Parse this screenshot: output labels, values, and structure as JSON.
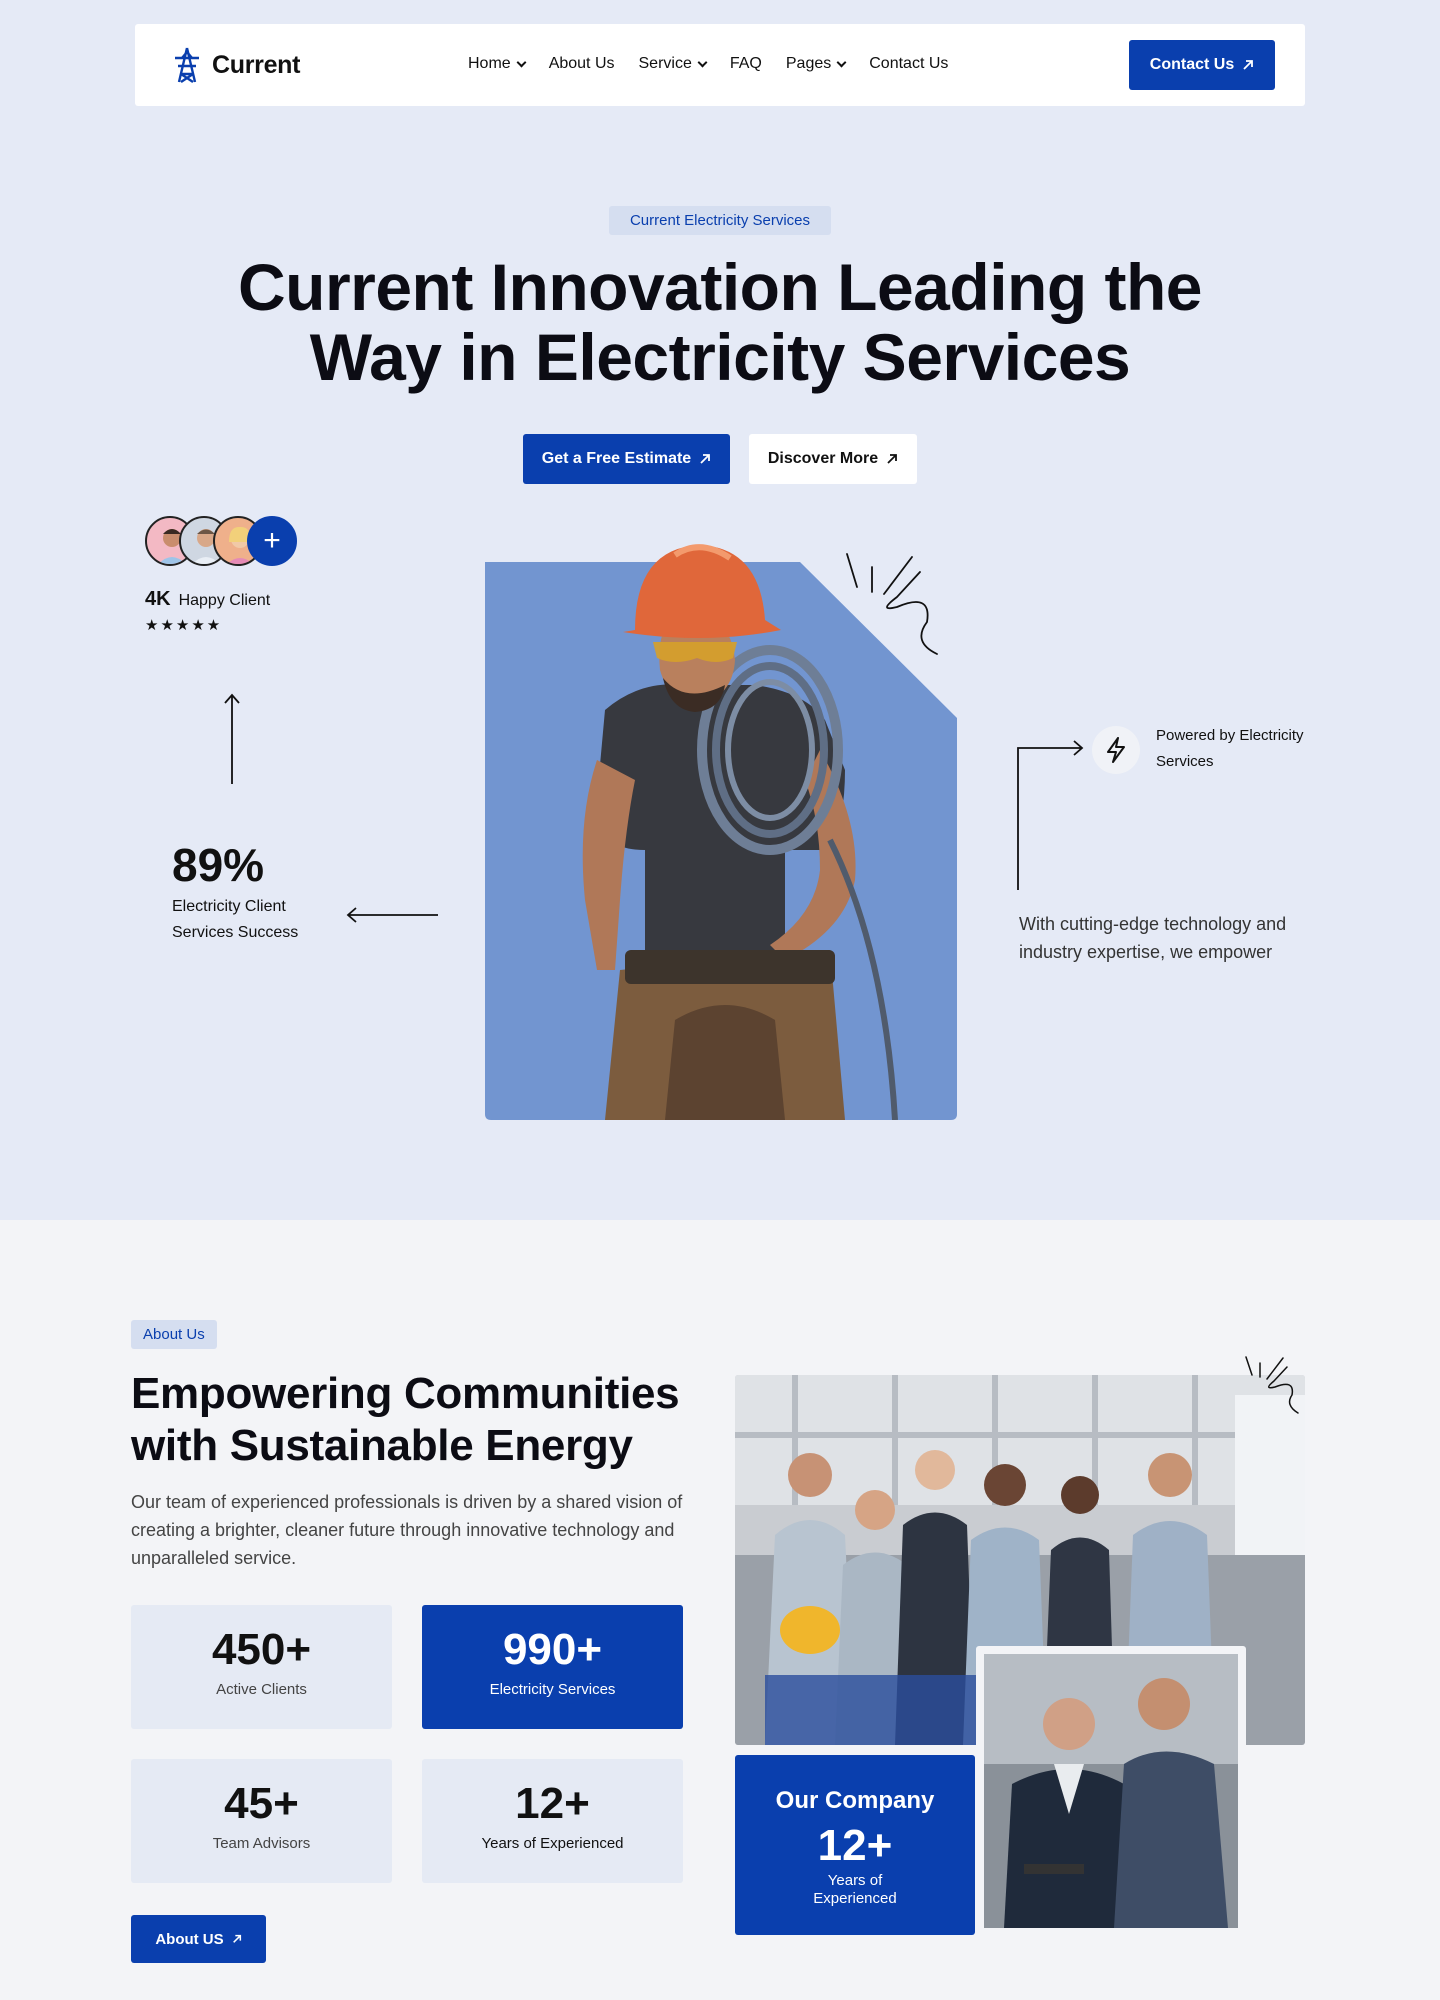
{
  "nav": {
    "logo_text": "Current",
    "menu": [
      {
        "label": "Home",
        "dropdown": true
      },
      {
        "label": "About Us",
        "dropdown": false
      },
      {
        "label": "Service",
        "dropdown": true
      },
      {
        "label": "FAQ",
        "dropdown": false
      },
      {
        "label": "Pages",
        "dropdown": true
      },
      {
        "label": "Contact Us",
        "dropdown": false
      }
    ],
    "contact_button": "Contact Us"
  },
  "hero": {
    "tag": "Current Electricity Services",
    "title_line1": "Current Innovation Leading the",
    "title_line2": "Way in Electricity Services",
    "estimate_button": "Get a Free Estimate",
    "discover_button": "Discover More",
    "happy_count": "4K",
    "happy_label": "Happy Client",
    "stars": "★★★★★",
    "rating": 5,
    "success_value": "89%",
    "success_label": "Electricity Client Services Success",
    "powered_label": "Powered by Electricity Services",
    "description": "With cutting-edge technology and industry expertise, we empower",
    "add_icon": "+"
  },
  "about": {
    "tag": "About Us",
    "title": "Empowering Communities with Sustainable Energy",
    "description": "Our team of experienced professionals is driven by a shared vision of creating a brighter, cleaner future through innovative technology and unparalleled service.",
    "stats": [
      {
        "value": "450+",
        "label": "Active Clients"
      },
      {
        "value": "990+",
        "label": "Electricity Services"
      },
      {
        "value": "45+",
        "label": "Team Advisors"
      },
      {
        "value": "12+",
        "label": "Years of Experienced"
      }
    ],
    "button": "About US",
    "company": {
      "title": "Our Company",
      "value": "12+",
      "label_line1": "Years of",
      "label_line2": "Experienced"
    }
  },
  "colors": {
    "primary": "#0a3fae",
    "hero_bg": "#e5eaf6",
    "image_bg": "#7295d0"
  }
}
